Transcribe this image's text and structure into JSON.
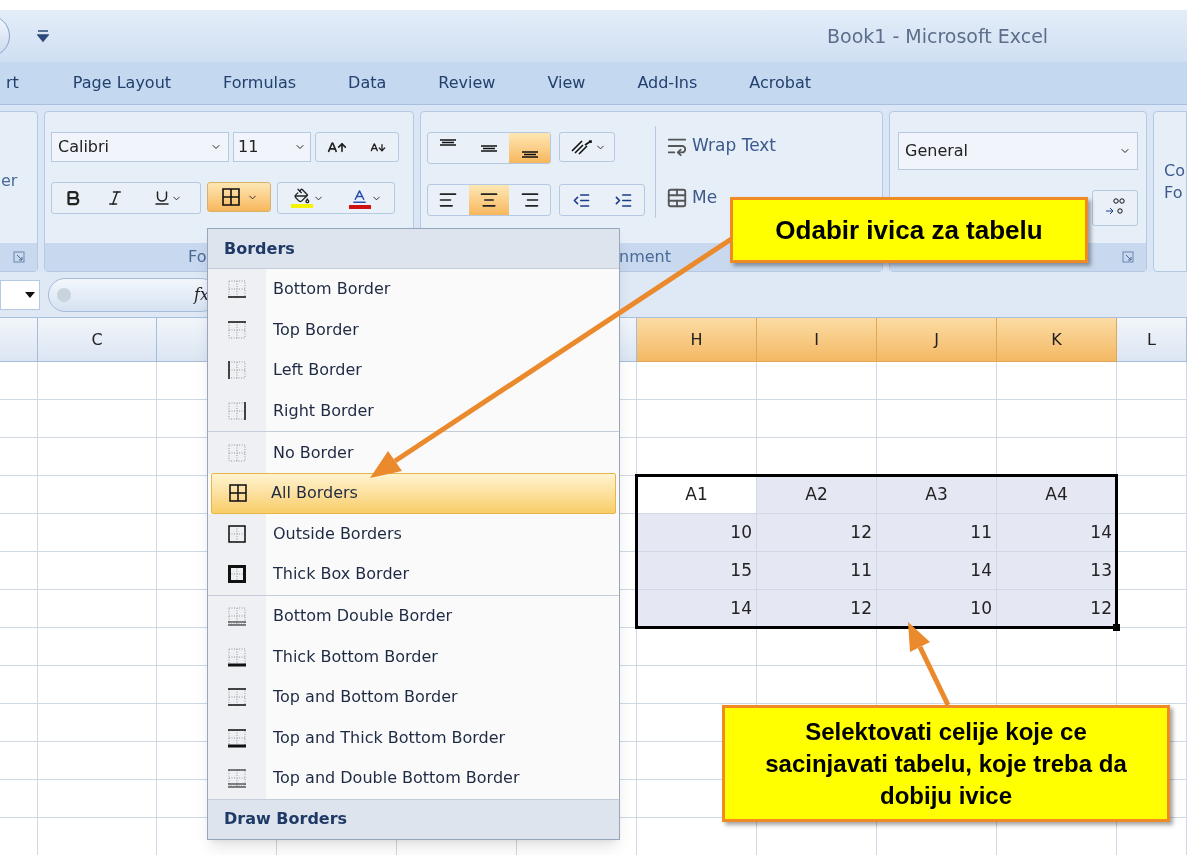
{
  "window": {
    "title": "Book1 - Microsoft Excel"
  },
  "tabs": [
    {
      "label": "rt",
      "selected": false
    },
    {
      "label": "Page Layout",
      "selected": false
    },
    {
      "label": "Formulas",
      "selected": false
    },
    {
      "label": "Data",
      "selected": false
    },
    {
      "label": "Review",
      "selected": false
    },
    {
      "label": "View",
      "selected": false
    },
    {
      "label": "Add-Ins",
      "selected": false
    },
    {
      "label": "Acrobat",
      "selected": false
    }
  ],
  "ribbon": {
    "left_group_label": "er",
    "font": {
      "name": "Calibri",
      "size": "11",
      "label": "Fo",
      "borders_selected": true
    },
    "align_vertical": [
      {
        "selected": false
      },
      {
        "selected": false
      },
      {
        "selected": true
      }
    ],
    "align_horizontal": [
      {
        "selected": false
      },
      {
        "selected": true
      },
      {
        "selected": false
      }
    ],
    "wrap_text": "Wrap Text",
    "merge": "Me",
    "alignment_label": "nment",
    "number_format": "General",
    "styles_lines": [
      "Co",
      "Fo"
    ]
  },
  "formula_bar": {
    "function_label": "fx"
  },
  "sheet": {
    "columns": [
      {
        "selected": false
      },
      {
        "label": "C",
        "selected": false
      },
      {
        "selected": false
      },
      {
        "selected": false
      },
      {
        "label": "H",
        "selected": true
      },
      {
        "label": "I",
        "selected": true
      },
      {
        "label": "J",
        "selected": true
      },
      {
        "label": "K",
        "selected": true
      },
      {
        "label": "L",
        "selected": false
      }
    ],
    "table": {
      "selected": true,
      "header": [
        "A1",
        "A2",
        "A3",
        "A4"
      ],
      "rows": [
        [
          "10",
          "12",
          "11",
          "14"
        ],
        [
          "15",
          "11",
          "14",
          "13"
        ],
        [
          "14",
          "12",
          "10",
          "12"
        ]
      ]
    }
  },
  "menu": {
    "title": "Borders",
    "sections": [
      {
        "items": [
          {
            "label": "Bottom Border",
            "selected": false
          },
          {
            "label": "Top Border",
            "selected": false
          },
          {
            "label": "Left Border",
            "selected": false
          },
          {
            "label": "Right Border",
            "selected": false
          }
        ]
      },
      {
        "items": [
          {
            "label": "No Border",
            "selected": false
          },
          {
            "label": "All Borders",
            "selected": true
          },
          {
            "label": "Outside Borders",
            "selected": false
          },
          {
            "label": "Thick Box Border",
            "selected": false
          }
        ]
      },
      {
        "items": [
          {
            "label": "Bottom Double Border",
            "selected": false
          },
          {
            "label": "Thick Bottom Border",
            "selected": false
          },
          {
            "label": "Top and Bottom Border",
            "selected": false
          },
          {
            "label": "Top and Thick Bottom Border",
            "selected": false
          },
          {
            "label": "Top and Double Bottom Border",
            "selected": false
          }
        ]
      }
    ],
    "footer": "Draw Borders"
  },
  "callouts": [
    {
      "text": "Odabir ivica za tabelu"
    },
    {
      "text": "Selektovati celije koje ce sacinjavati tabelu, koje treba da dobiju ivice"
    }
  ]
}
